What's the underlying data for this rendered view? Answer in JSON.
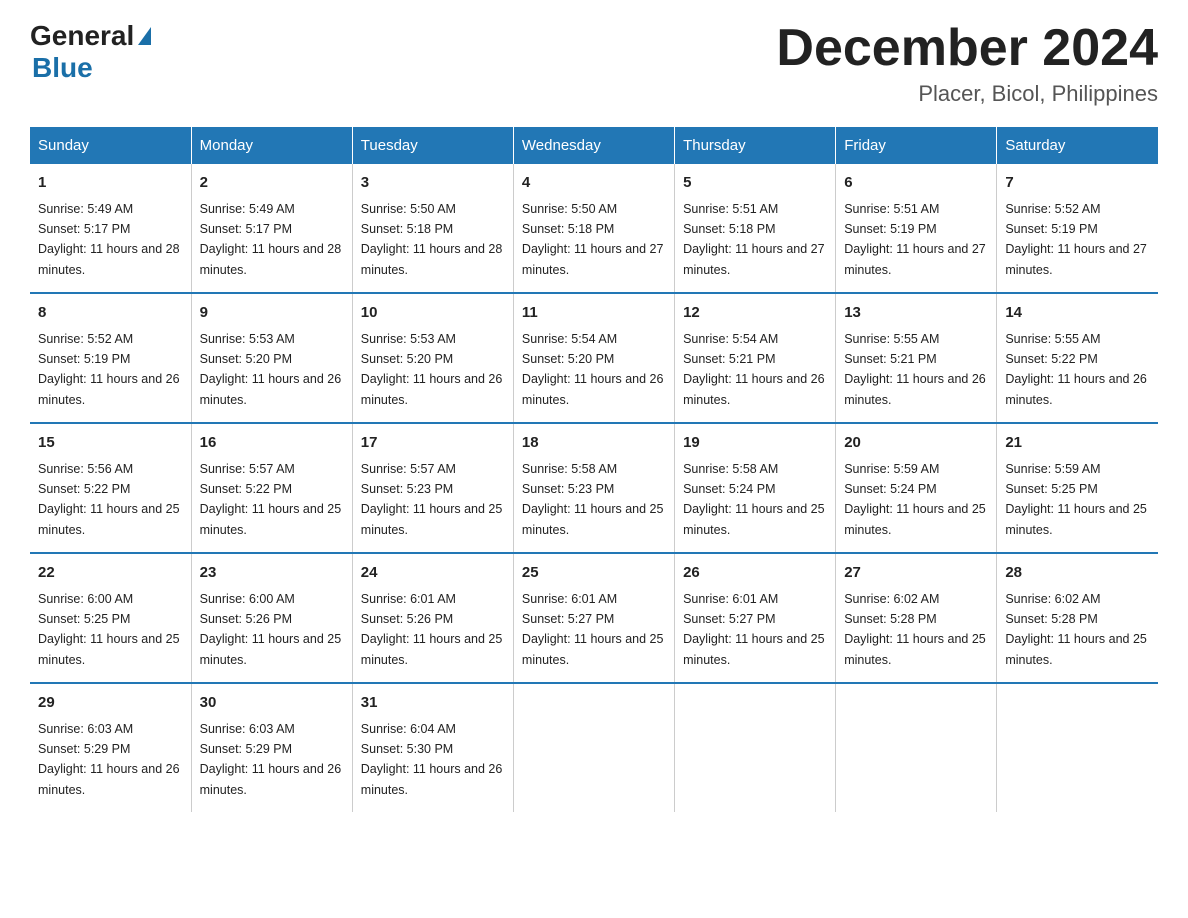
{
  "header": {
    "logo_general": "General",
    "logo_blue": "Blue",
    "month_title": "December 2024",
    "location": "Placer, Bicol, Philippines"
  },
  "days_of_week": [
    "Sunday",
    "Monday",
    "Tuesday",
    "Wednesday",
    "Thursday",
    "Friday",
    "Saturday"
  ],
  "weeks": [
    [
      {
        "day": "1",
        "sunrise": "5:49 AM",
        "sunset": "5:17 PM",
        "daylight": "11 hours and 28 minutes."
      },
      {
        "day": "2",
        "sunrise": "5:49 AM",
        "sunset": "5:17 PM",
        "daylight": "11 hours and 28 minutes."
      },
      {
        "day": "3",
        "sunrise": "5:50 AM",
        "sunset": "5:18 PM",
        "daylight": "11 hours and 28 minutes."
      },
      {
        "day": "4",
        "sunrise": "5:50 AM",
        "sunset": "5:18 PM",
        "daylight": "11 hours and 27 minutes."
      },
      {
        "day": "5",
        "sunrise": "5:51 AM",
        "sunset": "5:18 PM",
        "daylight": "11 hours and 27 minutes."
      },
      {
        "day": "6",
        "sunrise": "5:51 AM",
        "sunset": "5:19 PM",
        "daylight": "11 hours and 27 minutes."
      },
      {
        "day": "7",
        "sunrise": "5:52 AM",
        "sunset": "5:19 PM",
        "daylight": "11 hours and 27 minutes."
      }
    ],
    [
      {
        "day": "8",
        "sunrise": "5:52 AM",
        "sunset": "5:19 PM",
        "daylight": "11 hours and 26 minutes."
      },
      {
        "day": "9",
        "sunrise": "5:53 AM",
        "sunset": "5:20 PM",
        "daylight": "11 hours and 26 minutes."
      },
      {
        "day": "10",
        "sunrise": "5:53 AM",
        "sunset": "5:20 PM",
        "daylight": "11 hours and 26 minutes."
      },
      {
        "day": "11",
        "sunrise": "5:54 AM",
        "sunset": "5:20 PM",
        "daylight": "11 hours and 26 minutes."
      },
      {
        "day": "12",
        "sunrise": "5:54 AM",
        "sunset": "5:21 PM",
        "daylight": "11 hours and 26 minutes."
      },
      {
        "day": "13",
        "sunrise": "5:55 AM",
        "sunset": "5:21 PM",
        "daylight": "11 hours and 26 minutes."
      },
      {
        "day": "14",
        "sunrise": "5:55 AM",
        "sunset": "5:22 PM",
        "daylight": "11 hours and 26 minutes."
      }
    ],
    [
      {
        "day": "15",
        "sunrise": "5:56 AM",
        "sunset": "5:22 PM",
        "daylight": "11 hours and 25 minutes."
      },
      {
        "day": "16",
        "sunrise": "5:57 AM",
        "sunset": "5:22 PM",
        "daylight": "11 hours and 25 minutes."
      },
      {
        "day": "17",
        "sunrise": "5:57 AM",
        "sunset": "5:23 PM",
        "daylight": "11 hours and 25 minutes."
      },
      {
        "day": "18",
        "sunrise": "5:58 AM",
        "sunset": "5:23 PM",
        "daylight": "11 hours and 25 minutes."
      },
      {
        "day": "19",
        "sunrise": "5:58 AM",
        "sunset": "5:24 PM",
        "daylight": "11 hours and 25 minutes."
      },
      {
        "day": "20",
        "sunrise": "5:59 AM",
        "sunset": "5:24 PM",
        "daylight": "11 hours and 25 minutes."
      },
      {
        "day": "21",
        "sunrise": "5:59 AM",
        "sunset": "5:25 PM",
        "daylight": "11 hours and 25 minutes."
      }
    ],
    [
      {
        "day": "22",
        "sunrise": "6:00 AM",
        "sunset": "5:25 PM",
        "daylight": "11 hours and 25 minutes."
      },
      {
        "day": "23",
        "sunrise": "6:00 AM",
        "sunset": "5:26 PM",
        "daylight": "11 hours and 25 minutes."
      },
      {
        "day": "24",
        "sunrise": "6:01 AM",
        "sunset": "5:26 PM",
        "daylight": "11 hours and 25 minutes."
      },
      {
        "day": "25",
        "sunrise": "6:01 AM",
        "sunset": "5:27 PM",
        "daylight": "11 hours and 25 minutes."
      },
      {
        "day": "26",
        "sunrise": "6:01 AM",
        "sunset": "5:27 PM",
        "daylight": "11 hours and 25 minutes."
      },
      {
        "day": "27",
        "sunrise": "6:02 AM",
        "sunset": "5:28 PM",
        "daylight": "11 hours and 25 minutes."
      },
      {
        "day": "28",
        "sunrise": "6:02 AM",
        "sunset": "5:28 PM",
        "daylight": "11 hours and 25 minutes."
      }
    ],
    [
      {
        "day": "29",
        "sunrise": "6:03 AM",
        "sunset": "5:29 PM",
        "daylight": "11 hours and 26 minutes."
      },
      {
        "day": "30",
        "sunrise": "6:03 AM",
        "sunset": "5:29 PM",
        "daylight": "11 hours and 26 minutes."
      },
      {
        "day": "31",
        "sunrise": "6:04 AM",
        "sunset": "5:30 PM",
        "daylight": "11 hours and 26 minutes."
      },
      null,
      null,
      null,
      null
    ]
  ]
}
